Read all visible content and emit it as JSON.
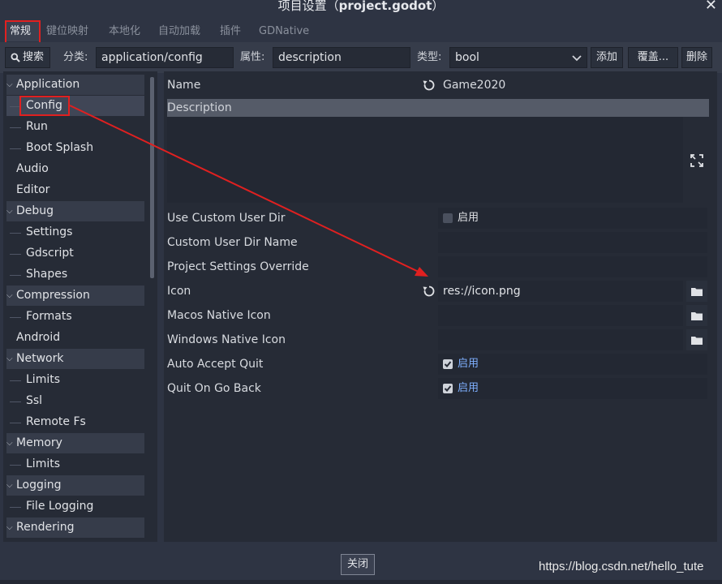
{
  "window": {
    "title_prefix": "项目设置（",
    "title_bold": "project.godot",
    "title_suffix": "）",
    "close_glyph": "✕"
  },
  "tabs": [
    {
      "label": "常规",
      "active": true
    },
    {
      "label": "键位映射"
    },
    {
      "label": "本地化"
    },
    {
      "label": "自动加载"
    },
    {
      "label": "插件"
    },
    {
      "label": "GDNative"
    }
  ],
  "toolbar": {
    "search_label": "搜索",
    "category_label": "分类:",
    "category_value": "application/config",
    "property_label": "属性:",
    "property_value": "description",
    "type_label": "类型:",
    "type_value": "bool",
    "add_label": "添加",
    "override_label": "覆盖...",
    "delete_label": "删除"
  },
  "tree": [
    {
      "label": "Application",
      "level": 0,
      "section": true
    },
    {
      "label": "Config",
      "level": 1,
      "selected": true
    },
    {
      "label": "Run",
      "level": 1
    },
    {
      "label": "Boot Splash",
      "level": 1
    },
    {
      "label": "Audio",
      "level": 0
    },
    {
      "label": "Editor",
      "level": 0
    },
    {
      "label": "Debug",
      "level": 0,
      "section": true
    },
    {
      "label": "Settings",
      "level": 1
    },
    {
      "label": "Gdscript",
      "level": 1
    },
    {
      "label": "Shapes",
      "level": 1
    },
    {
      "label": "Compression",
      "level": 0,
      "section": true
    },
    {
      "label": "Formats",
      "level": 1
    },
    {
      "label": "Android",
      "level": 0
    },
    {
      "label": "Network",
      "level": 0,
      "section": true
    },
    {
      "label": "Limits",
      "level": 1
    },
    {
      "label": "Ssl",
      "level": 1
    },
    {
      "label": "Remote Fs",
      "level": 1
    },
    {
      "label": "Memory",
      "level": 0,
      "section": true
    },
    {
      "label": "Limits",
      "level": 1
    },
    {
      "label": "Logging",
      "level": 0,
      "section": true
    },
    {
      "label": "File Logging",
      "level": 1
    },
    {
      "label": "Rendering",
      "level": 0,
      "section": true
    }
  ],
  "properties": {
    "name_label": "Name",
    "name_value": "Game2020",
    "description_label": "Description",
    "enable_text": "启用",
    "rows": [
      {
        "label": "Use Custom User Dir",
        "kind": "check",
        "checked": false
      },
      {
        "label": "Custom User Dir Name",
        "kind": "text",
        "value": ""
      },
      {
        "label": "Project Settings Override",
        "kind": "text",
        "value": ""
      },
      {
        "label": "Icon",
        "kind": "file",
        "value": "res://icon.png",
        "revert": true
      },
      {
        "label": "Macos Native Icon",
        "kind": "file",
        "value": ""
      },
      {
        "label": "Windows Native Icon",
        "kind": "file",
        "value": ""
      },
      {
        "label": "Auto Accept Quit",
        "kind": "check",
        "checked": true
      },
      {
        "label": "Quit On Go Back",
        "kind": "check",
        "checked": true
      }
    ]
  },
  "footer": {
    "close_label": "关闭",
    "watermark": "https://blog.csdn.net/hello_tute"
  },
  "colors": {
    "annotation_red": "#e02020",
    "enabled_blue": "#7fb0ff"
  }
}
